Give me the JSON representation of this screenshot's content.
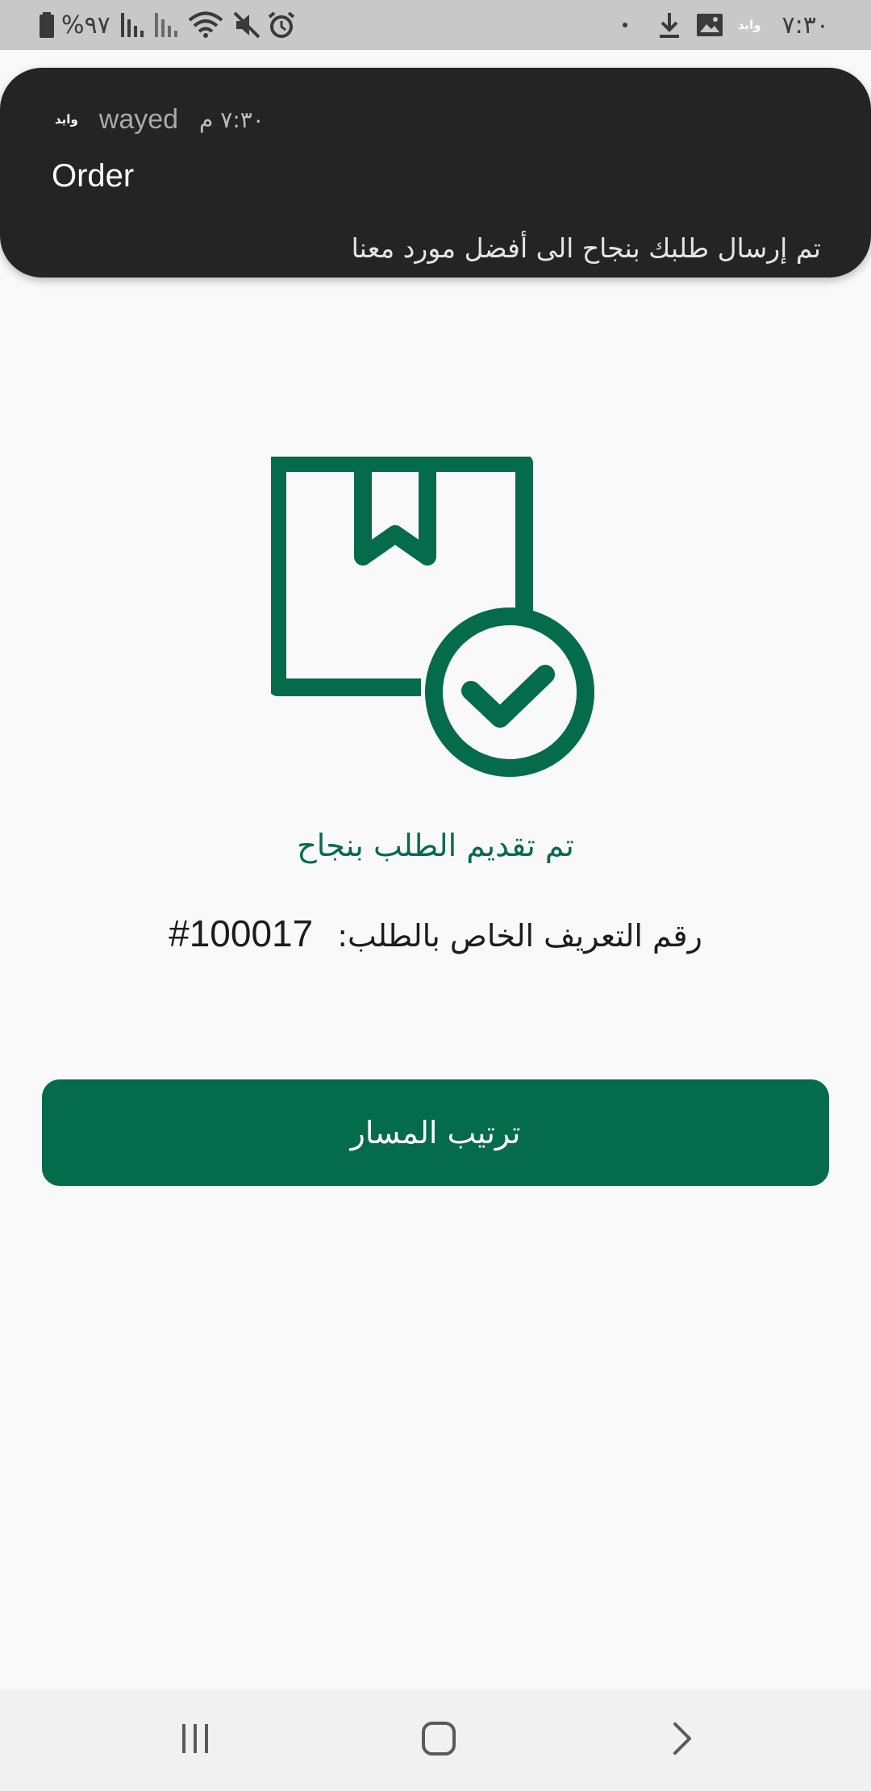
{
  "status_bar": {
    "battery_text": "%٩٧",
    "time": "٧:٣٠",
    "app_badge": "وايد",
    "icons": [
      "battery-icon",
      "signal-icon",
      "signal-icon-2",
      "wifi-icon",
      "mute-icon",
      "alarm-icon",
      "dot-icon",
      "download-icon",
      "image-icon"
    ]
  },
  "notification": {
    "app_badge": "وايد",
    "app_name": "wayed",
    "time": "٧:٣٠ م",
    "title": "Order",
    "body": "تم إرسال طلبك بنجاح الى أفضل مورد معنا"
  },
  "main": {
    "icon": "package-check-icon",
    "success_title": "تم تقديم الطلب بنجاح",
    "order_id_label": "رقم التعريف الخاص بالطلب:",
    "order_id_value": "#100017",
    "route_button_label": "ترتيب المسار"
  },
  "nav_bar": {
    "icons": [
      "recent-apps-icon",
      "home-icon",
      "back-icon"
    ]
  },
  "colors": {
    "accent": "#046b4b",
    "status_bar_bg": "#c8c8c8",
    "notification_bg": "#242424",
    "page_bg": "#f9f9f9",
    "nav_bar_bg": "#f1f1f1"
  }
}
